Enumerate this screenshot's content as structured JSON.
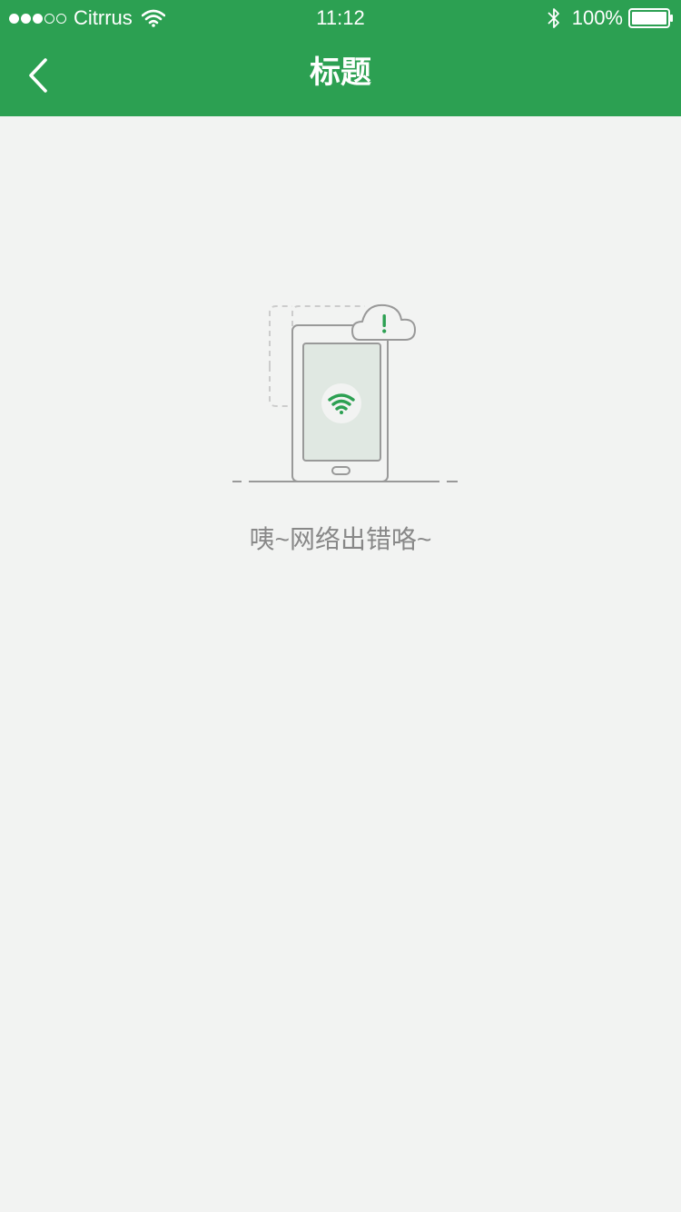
{
  "status_bar": {
    "carrier": "Citrrus",
    "time": "11:12",
    "battery_percent": "100%",
    "signal_bars_filled": 3,
    "signal_bars_total": 5
  },
  "nav": {
    "title": "标题",
    "back_icon": "chevron-left-icon"
  },
  "empty_state": {
    "message": "咦~网络出错咯~",
    "illustration_icons": [
      "phone-icon",
      "wifi-icon",
      "cloud-alert-icon"
    ]
  },
  "colors": {
    "brand_green": "#2ca052",
    "background": "#f2f3f2",
    "text_muted": "#888888",
    "illustration_stroke": "#999999",
    "screen_fill": "#e0e8e2"
  }
}
